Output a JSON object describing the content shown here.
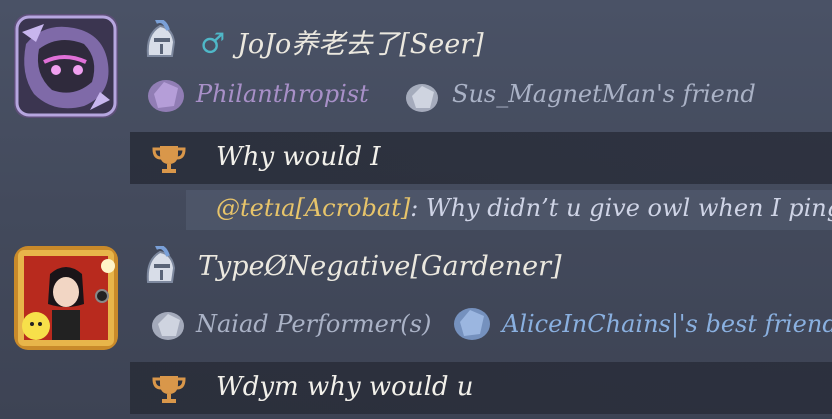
{
  "posts": [
    {
      "gender_symbol": "♂",
      "username": "JoJo养老去了[Seer]",
      "badges": [
        {
          "label": "Philanthropist",
          "color": "#a890c8",
          "icon": "purple-quartz-icon"
        },
        {
          "label": "Sus_MagnetMan's friend",
          "color": "#aab2c6",
          "icon": "white-quartz-icon"
        }
      ],
      "message": "Why would I",
      "reply": {
        "mention": "@tetıa[Acrobat]",
        "text": ": Why didn’t u give owl when I ping"
      }
    },
    {
      "username": "TypeØNegative[Gardener]",
      "badges": [
        {
          "label": "Naiad Performer(s)",
          "color": "#aab2c6",
          "icon": "white-quartz-icon"
        },
        {
          "label": "AliceInChains|'s best friend",
          "color": "#8ab0e0",
          "icon": "blue-quartz-icon"
        }
      ],
      "message": "Wdym why would u"
    }
  ],
  "colors": {
    "accent_gender": "#4fb8c8",
    "mention": "#e7c46a",
    "trophy": "#d9974a"
  }
}
